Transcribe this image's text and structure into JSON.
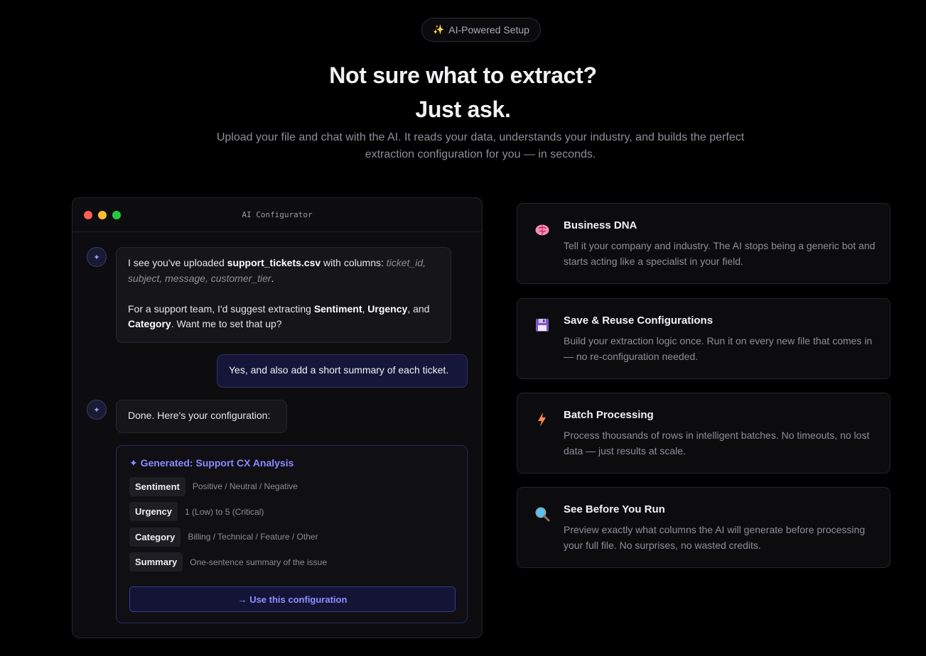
{
  "hero": {
    "badge_icon": "sparkles-icon",
    "badge_label": "AI-Powered Setup",
    "title_line1": "Not sure what to extract?",
    "title_line2": "Just ask.",
    "subtitle": "Upload your file and chat with the AI. It reads your data, understands your industry, and builds the perfect extraction configuration for you — in seconds."
  },
  "chat": {
    "window_title": "AI Configurator",
    "messages": [
      {
        "role": "assistant",
        "p1_pre": "I see you've uploaded ",
        "p1_file": "support_tickets.csv",
        "p1_mid": " with columns: ",
        "p1_columns": "ticket_id, subject, message, customer_tier",
        "p1_end": ".",
        "p2_pre": "For a support team, I'd suggest extracting ",
        "p2_f1": "Sentiment",
        "p2_sep1": ", ",
        "p2_f2": "Urgency",
        "p2_sep2": ", and ",
        "p2_f3": "Category",
        "p2_end": ". Want me to set that up?"
      },
      {
        "role": "user",
        "text": "Yes, and also add a short summary of each ticket."
      },
      {
        "role": "assistant",
        "text": "Done. Here's your configuration:"
      }
    ],
    "config": {
      "title": "✦ Generated: Support CX Analysis",
      "rows": [
        {
          "tag": "Sentiment",
          "desc": "Positive / Neutral / Negative"
        },
        {
          "tag": "Urgency",
          "desc": "1 (Low) to 5 (Critical)"
        },
        {
          "tag": "Category",
          "desc": "Billing / Technical / Feature / Other"
        },
        {
          "tag": "Summary",
          "desc": "One-sentence summary of the issue"
        }
      ],
      "button_label": "→ Use this configuration"
    }
  },
  "features": [
    {
      "icon": "brain-icon",
      "title": "Business DNA",
      "desc": "Tell it your company and industry. The AI stops being a generic bot and starts acting like a specialist in your field."
    },
    {
      "icon": "floppy-disk-icon",
      "title": "Save & Reuse Configurations",
      "desc": "Build your extraction logic once. Run it on every new file that comes in — no re-configuration needed."
    },
    {
      "icon": "lightning-icon",
      "title": "Batch Processing",
      "desc": "Process thousands of rows in intelligent batches. No timeouts, no lost data — just results at scale."
    },
    {
      "icon": "magnifier-icon",
      "title": "See Before You Run",
      "desc": "Preview exactly what columns the AI will generate before processing your full file. No surprises, no wasted credits."
    }
  ],
  "colors": {
    "background": "#000000",
    "accent": "#8b8bff",
    "card_border": "#24242a"
  }
}
